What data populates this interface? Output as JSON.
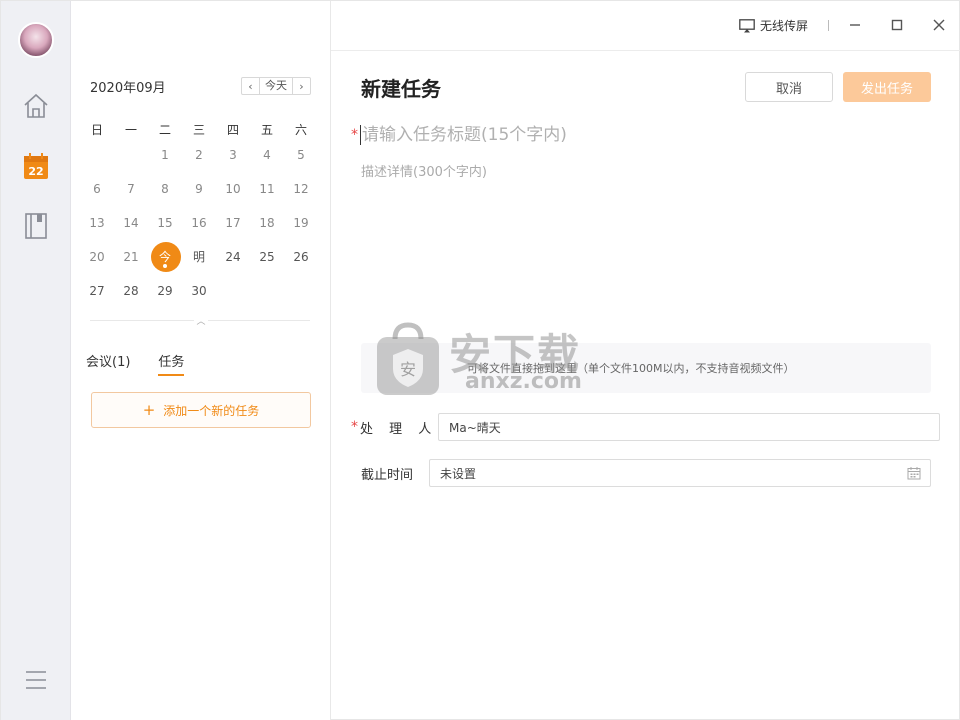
{
  "titlebar": {
    "cast_label": "无线传屏"
  },
  "sidebar": {
    "calendar_icon_day": "22"
  },
  "calendar": {
    "month_title": "2020年09月",
    "today_button": "今天",
    "weekdays": [
      "日",
      "一",
      "二",
      "三",
      "四",
      "五",
      "六"
    ],
    "weeks": [
      [
        "",
        "",
        "1",
        "2",
        "3",
        "4",
        "5"
      ],
      [
        "6",
        "7",
        "8",
        "9",
        "10",
        "11",
        "12"
      ],
      [
        "13",
        "14",
        "15",
        "16",
        "17",
        "18",
        "19"
      ],
      [
        "20",
        "21",
        "今",
        "明",
        "24",
        "25",
        "26"
      ],
      [
        "27",
        "28",
        "29",
        "30",
        "",
        "",
        ""
      ]
    ],
    "tabs": [
      "会议(1)",
      "任务"
    ],
    "add_task_label": "添加一个新的任务"
  },
  "form": {
    "heading": "新建任务",
    "cancel_label": "取消",
    "publish_label": "发出任务",
    "title_placeholder": "请输入任务标题(15个字内)",
    "desc_placeholder": "描述详情(300个字内)",
    "drop_hint": "可将文件直接拖到这里（单个文件100M以内，不支持音视频文件）",
    "handler_label": "处 理 人",
    "handler_value": "Ma~晴天",
    "deadline_label": "截止时间",
    "deadline_value": "未设置"
  },
  "watermark": {
    "text": "安下载",
    "sub": "anxz.com"
  },
  "colors": {
    "accent": "#f08a16",
    "publish_disabled": "#fcc99a",
    "required": "#e64545"
  }
}
